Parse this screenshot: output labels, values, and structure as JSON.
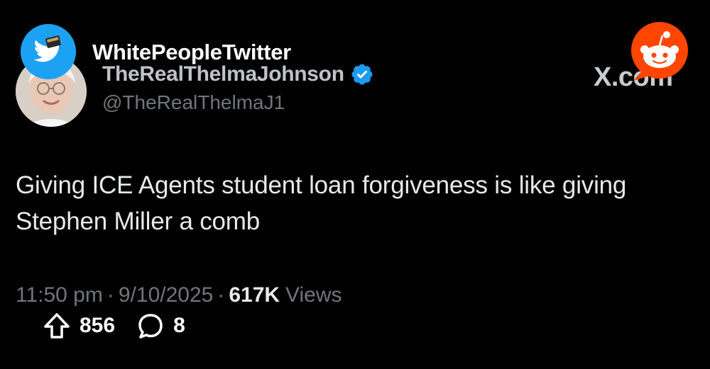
{
  "subreddit": {
    "name": "WhitePeopleTwitter",
    "icon": "twitter-bird-icon",
    "icon_color": "#1da1f2"
  },
  "reddit": {
    "logo": "reddit-snoo-logo",
    "brand_color": "#ff4500"
  },
  "tweet": {
    "display_name": "TheRealThelmaJohnson",
    "handle": "@TheRealThelmaJ1",
    "verified": true,
    "verified_color": "#1d9bf0",
    "source_watermark": "X.com",
    "text": "Giving ICE Agents student loan forgiveness is like giving Stephen Miller a comb",
    "time": "11:50 pm",
    "separator": "·",
    "date": "9/10/2025",
    "views_count": "617K",
    "views_label": "Views"
  },
  "post_stats": {
    "upvotes": "856",
    "upvote_icon": "upvote-arrow-icon",
    "comments": "8",
    "comment_icon": "comment-bubble-icon"
  }
}
